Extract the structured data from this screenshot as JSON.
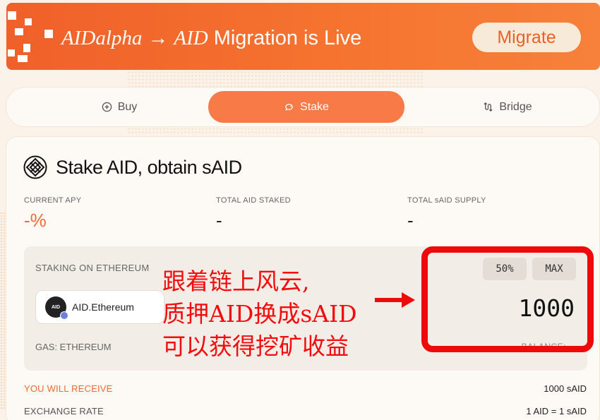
{
  "banner": {
    "title_from": "AIDalpha",
    "arrow": "→",
    "title_to": "AID",
    "title_rest": "Migration is Live",
    "migrate_label": "Migrate"
  },
  "tabs": [
    {
      "label": "Buy",
      "icon": "plus-circle-icon"
    },
    {
      "label": "Stake",
      "icon": "piggy-bank-icon",
      "active": true
    },
    {
      "label": "Bridge",
      "icon": "bridge-icon"
    }
  ],
  "card": {
    "title": "Stake AID, obtain sAID",
    "stats": [
      {
        "label": "CURRENT APY",
        "value": "-%"
      },
      {
        "label": "TOTAL AID STAKED",
        "value": "-"
      },
      {
        "label": "TOTAL sAID SUPPLY",
        "value": "-"
      }
    ],
    "staking_label": "STAKING ON ETHEREUM",
    "token_name": "AID.Ethereum",
    "token_logo_text": "AID",
    "gas_label": "GAS: ETHEREUM",
    "balance_label": "BALANCE:",
    "half_label": "50%",
    "max_label": "MAX",
    "amount": "1000",
    "receive_label": "YOU WILL RECEIVE",
    "receive_value": "1000 sAID",
    "rate_label": "EXCHANGE RATE",
    "rate_value": "1 AID = 1 sAID"
  },
  "annotation": {
    "line1": "跟着链上风云,",
    "line2": "质押AID换成sAID",
    "line3": "可以获得挖矿收益"
  },
  "colors": {
    "accent": "#f06a35",
    "banner": "#f5732f",
    "annotation_red": "#ee0a0a"
  }
}
